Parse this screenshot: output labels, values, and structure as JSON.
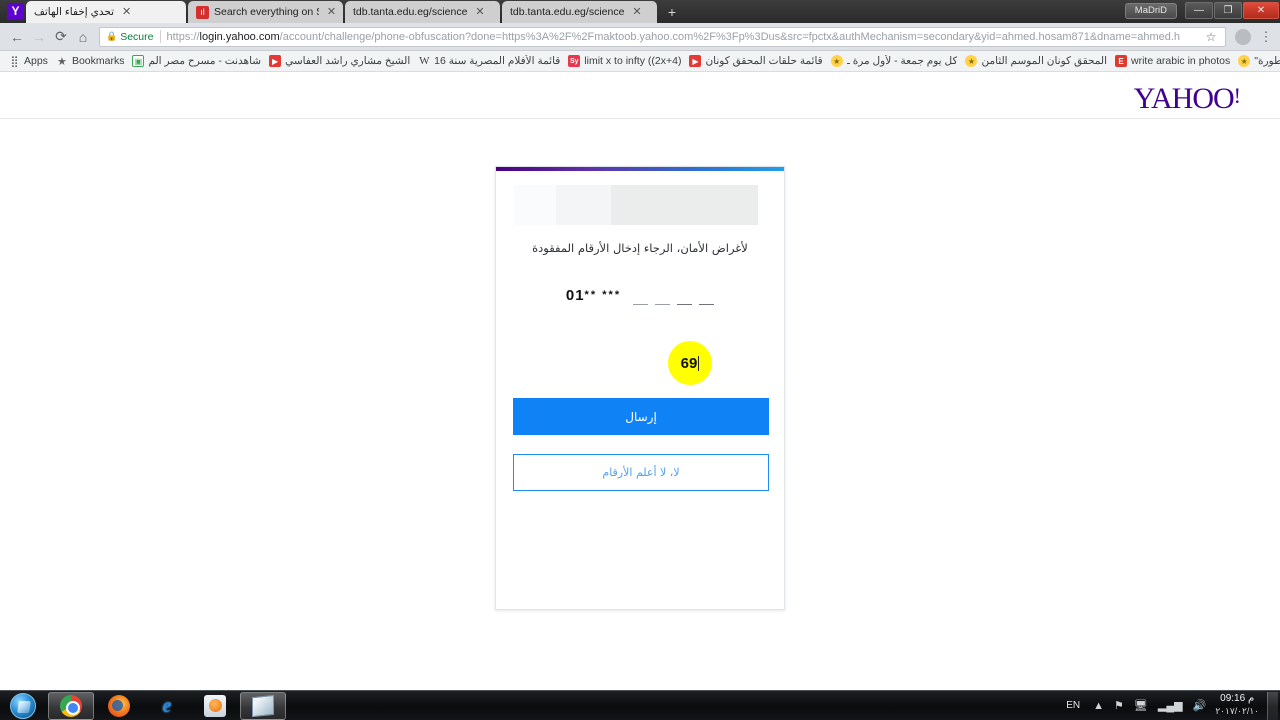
{
  "window": {
    "profile_label": "MaDriD",
    "minimize": "—",
    "maximize": "❐",
    "close": "✕"
  },
  "tabs": [
    {
      "title": "تحدي إخفاء الهاتف",
      "favicon": "yahoo-icon",
      "active": true,
      "rtl": true,
      "close": "✕"
    },
    {
      "title": "Search everything on So",
      "favicon": "scribd-icon",
      "active": false,
      "rtl": false,
      "close": "✕"
    },
    {
      "title": "tdb.tanta.edu.eg/science",
      "favicon": "page-icon",
      "active": false,
      "rtl": false,
      "close": "✕"
    },
    {
      "title": "tdb.tanta.edu.eg/science",
      "favicon": "page-icon",
      "active": false,
      "rtl": false,
      "close": "✕"
    }
  ],
  "newtab_label": "+",
  "toolbar": {
    "back_icon": "←",
    "forward_icon": "→",
    "reload_icon": "⟳",
    "home_icon": "⌂",
    "lock_icon": "🔒",
    "secure_label": "Secure",
    "url_scheme": "https://",
    "url_domain": "login.yahoo.com",
    "url_path": "/account/challenge/phone-obfuscation?done=https%3A%2F%2Fmaktoob.yahoo.com%2F%3Fp%3Dus&src=fpctx&authMechanism=secondary&yid=ahmed.hosam871&dname=ahmed.h",
    "star_icon": "☆",
    "extension_icon": "extension-icon",
    "menu_icon": "⋮"
  },
  "bookmarks": {
    "apps_label": "Apps",
    "bookmarks_label": "Bookmarks",
    "overflow_label": "»",
    "items": [
      {
        "label": "شاهدنت - مسرح مصر الم",
        "icon": "green-square-icon",
        "rtl": true
      },
      {
        "label": "الشيخ مشاري راشد العفاسي",
        "icon": "youtube-icon",
        "rtl": true
      },
      {
        "label": "قائمة الأفلام المصرية سنة 16",
        "icon": "wikipedia-icon",
        "rtl": true
      },
      {
        "label": "limit x to infty ((2x+4)",
        "icon": "symbolab-icon",
        "rtl": false
      },
      {
        "label": "قائمة حلقات المحقق كونان",
        "icon": "youtube-icon",
        "rtl": true
      },
      {
        "label": "كل يوم جمعة - لأول مرة ـ",
        "icon": "gold-star-icon",
        "rtl": true
      },
      {
        "label": "المحقق كونان الموسم الثامن",
        "icon": "gold-star-icon",
        "rtl": true
      },
      {
        "label": "write arabic in photos",
        "icon": "edge-icon",
        "rtl": false
      },
      {
        "label": "نتائج البحث: \"افتار اسطورة\"",
        "icon": "gold-star-icon",
        "rtl": true
      }
    ]
  },
  "page": {
    "brand": "YAHOO",
    "brand_bang": "!",
    "card": {
      "instruction": "لأغراض الأمان، الرجاء إدخال الأرقام المفقودة",
      "masked_prefix": "01",
      "masked_group1": "**",
      "masked_group2": "***",
      "entered_digits": "69",
      "blank_cells": [
        "",
        ""
      ],
      "primary_button": "إرسال",
      "secondary_button": "لا، لا أعلم الأرقام"
    }
  },
  "taskbar": {
    "start_label": "start-orb",
    "items": [
      {
        "name": "chrome",
        "active": true
      },
      {
        "name": "firefox",
        "active": false
      },
      {
        "name": "internet-explorer",
        "active": false
      },
      {
        "name": "windows-media-player",
        "active": false
      },
      {
        "name": "unknown-app",
        "active": true
      }
    ],
    "tray": {
      "language": "EN",
      "show_hidden_icon": "▲",
      "flag_icon": "⚑",
      "action_center_icon": "🖥",
      "network_icon": "▂▄▆",
      "volume_icon": "🔊",
      "time": "09:16 م",
      "date": "٢٠١٧/٠٢/١٠"
    }
  },
  "colors": {
    "yahoo_purple": "#400090",
    "primary_blue": "#0f83f5",
    "secure_green": "#0b7c38",
    "highlight_yellow": "#ffff00"
  }
}
